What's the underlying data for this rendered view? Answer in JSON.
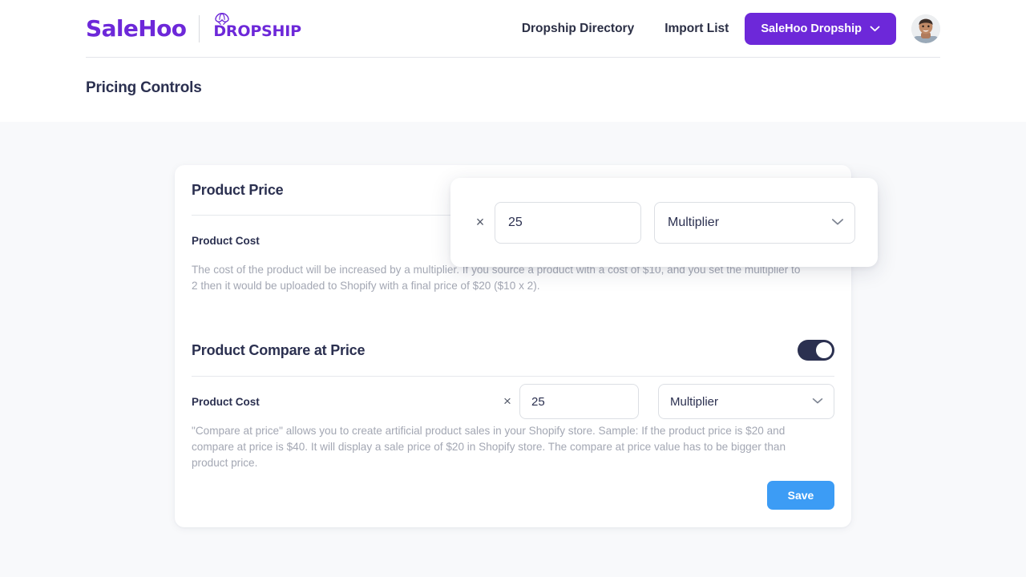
{
  "header": {
    "brand": {
      "salehoo": "SaleHoo",
      "dropship": "DROPSHIP",
      "parachute_icon": "parachute-icon",
      "brand_color": "#6d28d9"
    },
    "nav_links": [
      {
        "label": "Dropship Directory"
      },
      {
        "label": "Import List"
      }
    ],
    "account_button": {
      "label": "SaleHoo Dropship",
      "chevron_icon": "chevron-down-icon",
      "background": "#6d28d9"
    },
    "avatar_alt": "user-avatar"
  },
  "page_title": "Pricing Controls",
  "card": {
    "product_price": {
      "title": "Product Price",
      "field_label": "Product Cost",
      "times_symbol": "×",
      "amount_value": "25",
      "amount_placeholder": "25",
      "mode_value": "Multiplier",
      "chevron_icon": "chevron-down-icon",
      "help_text": "The cost of the product will be increased by a multiplier. If you source a product with a cost of $10, and you set the multiplier to 2 then it would be uploaded to Shopify with a final price of $20 ($10 x 2)."
    },
    "compare_at_price": {
      "title": "Product Compare at Price",
      "toggle_state": "on",
      "field_label": "Product Cost",
      "times_symbol": "×",
      "amount_value": "25",
      "amount_placeholder": "25",
      "mode_value": "Multiplier",
      "chevron_icon": "chevron-down-icon",
      "help_text": "\"Compare at price\" allows you to create artificial product sales in your Shopify store. Sample: If the product price is $20 and compare at price is $40. It will display a sale price of $20 in Shopify store. The compare at price value has to be bigger than product price."
    },
    "save_button": {
      "label": "Save",
      "background": "#3c9cf5"
    }
  },
  "popup": {
    "times_symbol": "×",
    "amount_value": "25",
    "amount_placeholder": "25",
    "mode_value": "Multiplier",
    "chevron_icon": "chevron-down-icon"
  },
  "colors": {
    "page_background": "#f8f9fb",
    "card_background": "#ffffff",
    "brand_purple": "#6d28d9",
    "accent_blue": "#3c9cf5",
    "toggle_on": "#2b3050",
    "text_dark": "#2b3050",
    "text_muted": "#a3a7b3"
  }
}
